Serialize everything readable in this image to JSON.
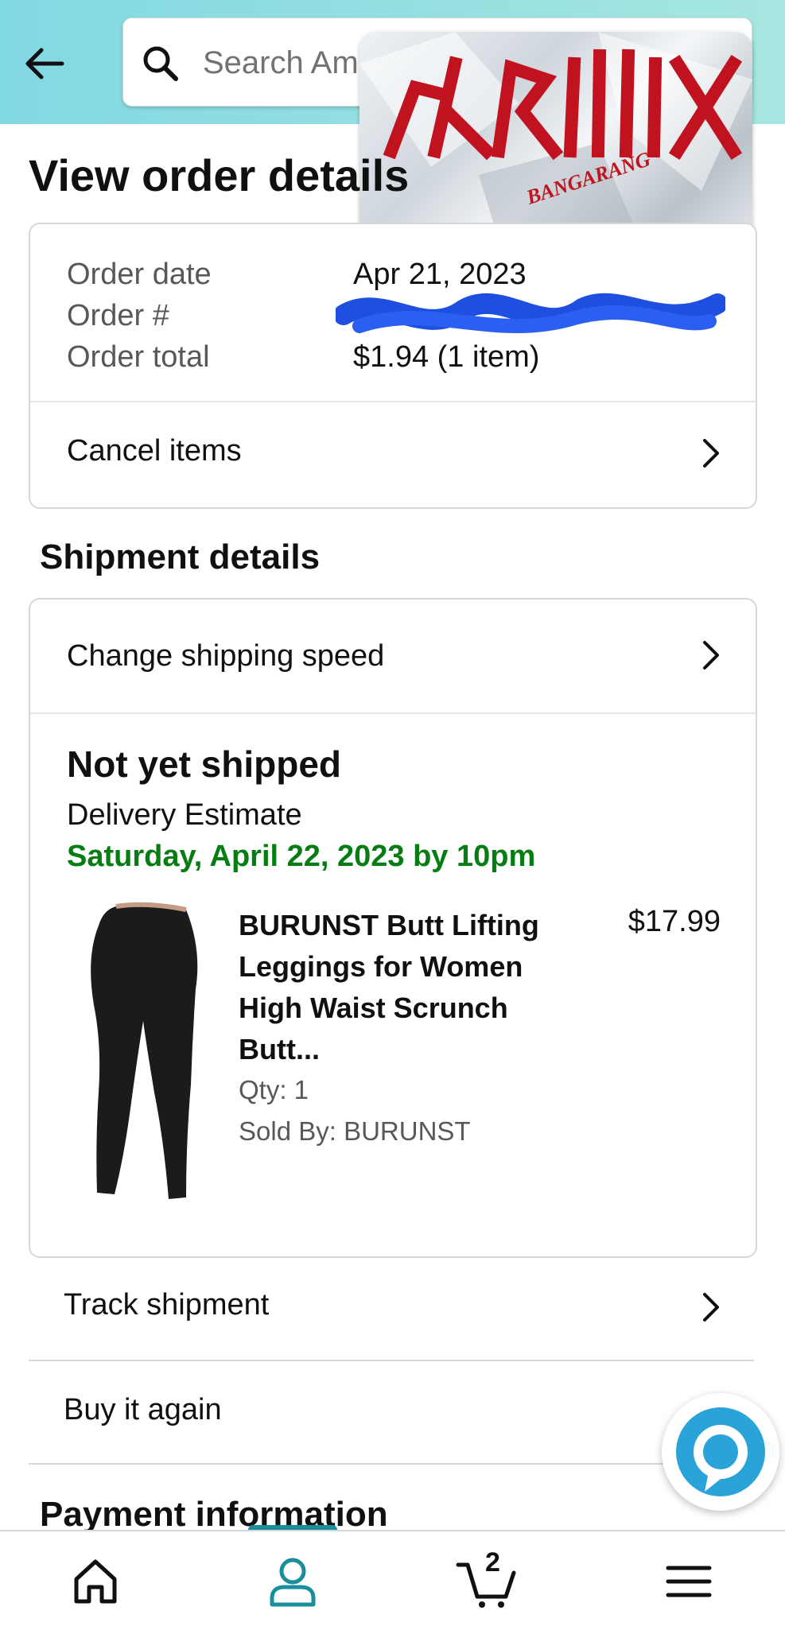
{
  "header": {
    "search_placeholder": "Search Amazon"
  },
  "page": {
    "title": "View order details"
  },
  "order_summary": {
    "date_label": "Order date",
    "date_value": "Apr 21, 2023",
    "number_label": "Order #",
    "total_label": "Order total",
    "total_value": "$1.94 (1 item)",
    "cancel_label": "Cancel items"
  },
  "shipment": {
    "section_title": "Shipment details",
    "change_speed_label": "Change shipping speed",
    "status": "Not yet shipped",
    "estimate_label": "Delivery Estimate",
    "estimate_date": "Saturday, April 22, 2023 by 10pm",
    "product": {
      "title": "BURUNST Butt Lifting Leggings for Women High Waist Scrunch Butt...",
      "price": "$17.99",
      "qty": "Qty: 1",
      "sold_by": "Sold By: BURUNST"
    }
  },
  "actions": {
    "track": "Track shipment",
    "buy_again": "Buy it again"
  },
  "payment": {
    "section_title": "Payment information"
  },
  "nav": {
    "cart_count": "2"
  },
  "colors": {
    "header_start": "#82d8e3",
    "header_end": "#a6e6e0",
    "delivery_green": "#067d13",
    "nav_active": "#1a8e9d"
  },
  "icons": [
    "back-arrow-icon",
    "search-icon",
    "chevron-right-icon",
    "alexa-icon",
    "home-icon",
    "account-icon",
    "cart-icon",
    "menu-icon"
  ]
}
